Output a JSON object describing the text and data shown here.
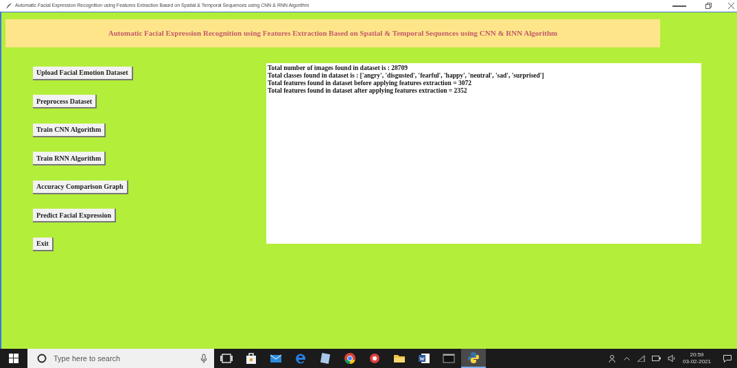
{
  "window": {
    "title": "Automatic Facial Expression Recognition using Features Extraction Based on Spatial & Temporal Sequences using CNN & RNN Algorithm"
  },
  "header": {
    "title": "Automatic Facial Expression Recognition using Features Extraction Based on Spatial & Temporal Sequences using CNN & RNN Algorithm"
  },
  "buttons": [
    "Upload Facial Emotion Dataset",
    "Preprocess Dataset",
    "Train CNN Algorithm",
    "Train RNN Algorithm",
    "Accuracy Comparison Graph",
    "Predict Facial Expression",
    "Exit"
  ],
  "output": {
    "lines": [
      "Total number of images found in dataset is : 28709",
      "Total classes found in dataset is : ['angry', 'disgusted', 'fearful', 'happy', 'neutral', 'sad', 'surprised']",
      "Total features found in dataset before applying features extraction = 3072",
      "Total features found in dataset after applying features extraction = 2352"
    ]
  },
  "taskbar": {
    "search": {
      "placeholder": "Type here to search"
    },
    "apps": [
      {
        "kind": "task-view",
        "selected": false
      },
      {
        "kind": "store",
        "selected": false
      },
      {
        "kind": "mail",
        "selected": false
      },
      {
        "kind": "edge",
        "selected": false
      },
      {
        "kind": "notes",
        "selected": false
      },
      {
        "kind": "chrome",
        "selected": false
      },
      {
        "kind": "red-app",
        "selected": false
      },
      {
        "kind": "folder",
        "selected": false
      },
      {
        "kind": "word",
        "selected": false
      },
      {
        "kind": "terminal",
        "selected": false
      },
      {
        "kind": "python",
        "selected": true
      }
    ],
    "time": "20:59",
    "date": "03-02-2021"
  }
}
